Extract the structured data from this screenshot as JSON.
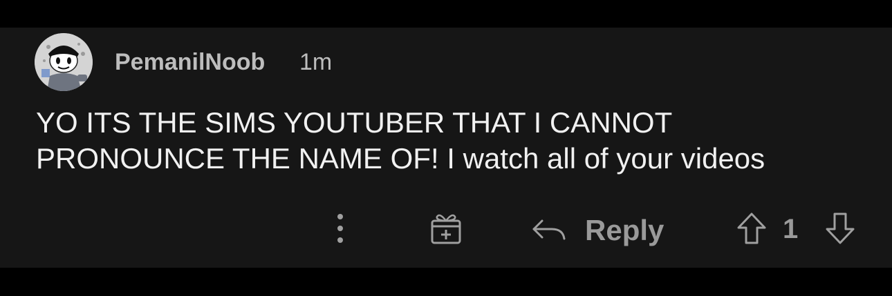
{
  "comment": {
    "username": "PemanilNoob",
    "timestamp": "1m",
    "body_lines": [
      "YO ITS THE SIMS YOUTUBER THAT I CANNOT",
      "PRONOUNCE THE NAME OF! I watch all of your videos"
    ],
    "avatar_icon": "avatar-snoo-icon"
  },
  "actions": {
    "more_icon": "more-vertical-icon",
    "award_icon": "award-gift-icon",
    "reply_icon": "reply-arrow-icon",
    "reply_label": "Reply",
    "upvote_icon": "upvote-arrow-icon",
    "vote_count": "1",
    "downvote_icon": "downvote-arrow-icon"
  },
  "colors": {
    "page_background": "#000000",
    "card_background": "#161616",
    "body_text": "#f1f1f1",
    "meta_text": "#bdbdbd",
    "action_text": "#9a9a9a"
  }
}
